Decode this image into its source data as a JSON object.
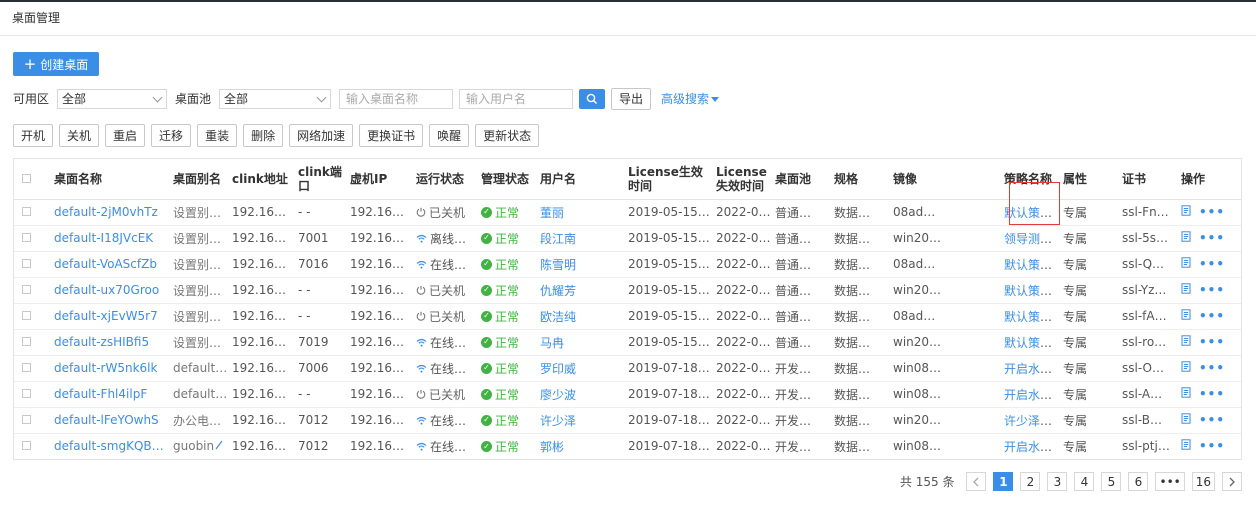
{
  "page_title": "桌面管理",
  "create_button": "创建桌面",
  "filters": {
    "zone_label": "可用区",
    "zone_value": "全部",
    "pool_label": "桌面池",
    "pool_value": "全部",
    "desktop_name_placeholder": "输入桌面名称",
    "user_name_placeholder": "输入用户名",
    "export_label": "导出",
    "advanced_search_label": "高级搜索"
  },
  "actions": [
    "开机",
    "关机",
    "重启",
    "迁移",
    "重装",
    "删除",
    "网络加速",
    "更换证书",
    "唤醒",
    "更新状态"
  ],
  "table": {
    "headers": [
      "桌面名称",
      "桌面别名",
      "clink地址",
      "clink端口",
      "虚机IP",
      "运行状态",
      "管理状态",
      "用户名",
      "License生效时间",
      "License失效时间",
      "桌面池",
      "规格",
      "镜像",
      "策略名称",
      "属性",
      "证书",
      "操作"
    ],
    "rows": [
      {
        "name": "default-2jM0vhTz",
        "alias": "设置别名",
        "clink": "192.16…",
        "port": "- -",
        "ip": "192.16…",
        "run": "已关机",
        "run_state": "off",
        "mgmt": "正常",
        "user": "董丽",
        "lic_start": "2019-05-15…",
        "lic_end": "2022-05-15…",
        "pool": "普通…",
        "spec": "数据…",
        "image": "08ad…",
        "policy": "默认策略",
        "attr": "专属",
        "cert": "ssl-Fn…"
      },
      {
        "name": "default-I18JVcEK",
        "alias": "设置别名",
        "clink": "192.16…",
        "port": "7001",
        "ip": "192.16…",
        "run": "离线…",
        "run_state": "net",
        "mgmt": "正常",
        "user": "段江南",
        "lic_start": "2019-05-15…",
        "lic_end": "2022-05-15…",
        "pool": "普通…",
        "spec": "数据…",
        "image": "win20…",
        "policy": "领导测试U盘只读…",
        "attr": "专属",
        "cert": "ssl-5s…"
      },
      {
        "name": "default-VoAScfZb",
        "alias": "设置别名",
        "clink": "192.16…",
        "port": "7016",
        "ip": "192.16…",
        "run": "在线…",
        "run_state": "net",
        "mgmt": "正常",
        "user": "陈雪明",
        "lic_start": "2019-05-15…",
        "lic_end": "2022-05-15…",
        "pool": "普通…",
        "spec": "数据…",
        "image": "08ad…",
        "policy": "默认策略",
        "attr": "专属",
        "cert": "ssl-Q…"
      },
      {
        "name": "default-ux70Groo",
        "alias": "设置别名",
        "clink": "192.16…",
        "port": "- -",
        "ip": "192.16…",
        "run": "已关机",
        "run_state": "off",
        "mgmt": "正常",
        "user": "仇耀芳",
        "lic_start": "2019-05-15…",
        "lic_end": "2022-05-15…",
        "pool": "普通…",
        "spec": "数据…",
        "image": "win20…",
        "policy": "默认策略",
        "attr": "专属",
        "cert": "ssl-Yz…"
      },
      {
        "name": "default-xjEvW5r7",
        "alias": "设置别名",
        "clink": "192.16…",
        "port": "- -",
        "ip": "192.16…",
        "run": "已关机",
        "run_state": "off",
        "mgmt": "正常",
        "user": "欧洁纯",
        "lic_start": "2019-05-15…",
        "lic_end": "2022-05-15…",
        "pool": "普通…",
        "spec": "数据…",
        "image": "08ad…",
        "policy": "默认策略",
        "attr": "专属",
        "cert": "ssl-fA…"
      },
      {
        "name": "default-zsHIBfi5",
        "alias": "设置别名",
        "clink": "192.16…",
        "port": "7019",
        "ip": "192.16…",
        "run": "在线…",
        "run_state": "net",
        "mgmt": "正常",
        "user": "马冉",
        "lic_start": "2019-05-15…",
        "lic_end": "2022-05-15…",
        "pool": "普通…",
        "spec": "数据…",
        "image": "win20…",
        "policy": "默认策略",
        "attr": "专属",
        "cert": "ssl-ro…"
      },
      {
        "name": "default-rW5nk6lk",
        "alias": "default-rW",
        "clink": "192.16…",
        "port": "7006",
        "ip": "192.16…",
        "run": "在线…",
        "run_state": "net",
        "mgmt": "正常",
        "user": "罗印威",
        "lic_start": "2019-07-18…",
        "lic_end": "2022-07-31…",
        "pool": "开发…",
        "spec": "数据…",
        "image": "win08…",
        "policy": "开启水印",
        "attr": "专属",
        "cert": "ssl-O…"
      },
      {
        "name": "default-Fhl4ilpF",
        "alias": "default-Fh",
        "clink": "192.16…",
        "port": "- -",
        "ip": "192.16…",
        "run": "已关机",
        "run_state": "off",
        "mgmt": "正常",
        "user": "廖少波",
        "lic_start": "2019-07-18…",
        "lic_end": "2022-07-31…",
        "pool": "开发…",
        "spec": "数据…",
        "image": "win08…",
        "policy": "开启水印",
        "attr": "专属",
        "cert": "ssl-A…"
      },
      {
        "name": "default-lFeYOwhS",
        "alias": "办公电脑",
        "clink": "192.16…",
        "port": "7012",
        "ip": "192.16…",
        "run": "在线…",
        "run_state": "net",
        "mgmt": "正常",
        "user": "许少泽",
        "lic_start": "2019-07-18…",
        "lic_end": "2022-07-31…",
        "pool": "开发…",
        "spec": "数据…",
        "image": "win20…",
        "policy": "许少泽的策略_117",
        "attr": "专属",
        "cert": "ssl-B…"
      },
      {
        "name": "default-smgKQB2m",
        "alias": "guobin",
        "clink": "192.16…",
        "port": "7012",
        "ip": "192.16…",
        "run": "在线…",
        "run_state": "net",
        "mgmt": "正常",
        "user": "郭彬",
        "lic_start": "2019-07-18…",
        "lic_end": "2022-07-31…",
        "pool": "开发…",
        "spec": "数据…",
        "image": "win08…",
        "policy": "开启水印",
        "attr": "专属",
        "cert": "ssl-ptj…"
      }
    ]
  },
  "pagination": {
    "total_text": "共 155 条",
    "pages": [
      "1",
      "2",
      "3",
      "4",
      "5",
      "6",
      "•••",
      "16"
    ],
    "current": "1"
  },
  "colors": {
    "accent": "#3a8ee6",
    "ok": "#43b244",
    "highlight": "#e23b3b"
  }
}
